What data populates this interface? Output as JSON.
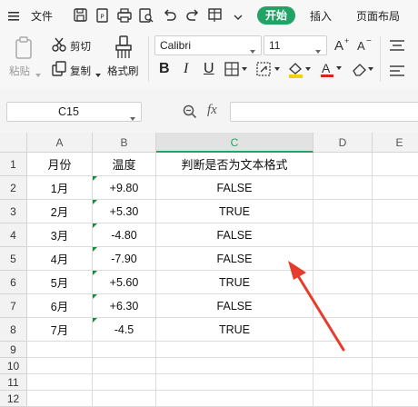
{
  "titlebar": {
    "menu": "文件",
    "tab_start": "开始",
    "tab_insert": "插入",
    "tab_layout": "页面布局"
  },
  "ribbon": {
    "paste": "粘贴",
    "cut": "剪切",
    "copy": "复制",
    "format_painter": "格式刷",
    "font_name": "Calibri",
    "font_size": "11",
    "bold": "B",
    "italic": "I",
    "underline": "U"
  },
  "formula_bar": {
    "name_box": "C15",
    "fx": "fx",
    "formula": ""
  },
  "grid": {
    "columns": [
      "A",
      "B",
      "C",
      "D",
      "E"
    ],
    "selected_column": "C",
    "rows": [
      "1",
      "2",
      "3",
      "4",
      "5",
      "6",
      "7",
      "8",
      "9",
      "10",
      "11",
      "12"
    ],
    "header_row": [
      "月份",
      "温度",
      "判断是否为文本格式"
    ],
    "data": [
      [
        "1月",
        "+9.80",
        "FALSE"
      ],
      [
        "2月",
        "+5.30",
        "TRUE"
      ],
      [
        "3月",
        "-4.80",
        "FALSE"
      ],
      [
        "4月",
        "-7.90",
        "FALSE"
      ],
      [
        "5月",
        "+5.60",
        "TRUE"
      ],
      [
        "6月",
        "+6.30",
        "FALSE"
      ],
      [
        "7月",
        "-4.5",
        "TRUE"
      ]
    ]
  },
  "colors": {
    "accent_green": "#21a366",
    "annotation_red": "#e53c2e",
    "text_indicator_green": "#1a8a3a"
  }
}
